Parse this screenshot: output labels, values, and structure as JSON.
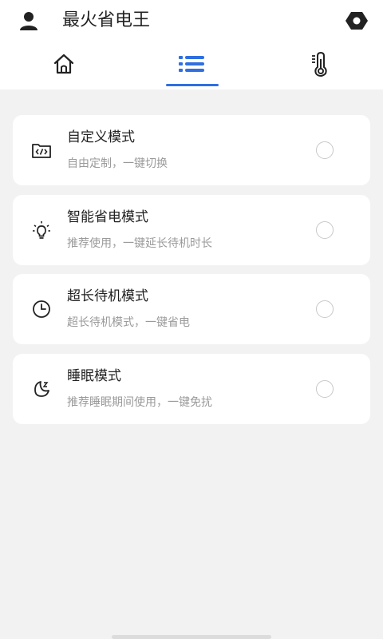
{
  "header": {
    "title": "最火省电王",
    "user_icon": "user-icon",
    "settings_icon": "gear-icon"
  },
  "tabs": [
    {
      "icon": "home-icon",
      "active": false
    },
    {
      "icon": "list-icon",
      "active": true
    },
    {
      "icon": "thermometer-icon",
      "active": false
    }
  ],
  "colors": {
    "accent": "#2f6fe0",
    "background": "#f2f2f2",
    "card": "#ffffff",
    "secondary_text": "#9a9a9a"
  },
  "modes": [
    {
      "title": "自定义模式",
      "desc": "自由定制，一键切换",
      "icon": "custom-code-icon",
      "selected": false
    },
    {
      "title": "智能省电模式",
      "desc": "推荐使用，一键延长待机时长",
      "icon": "lightbulb-icon",
      "selected": false
    },
    {
      "title": "超长待机模式",
      "desc": "超长待机模式，一键省电",
      "icon": "clock-icon",
      "selected": false
    },
    {
      "title": "睡眠模式",
      "desc": "推荐睡眠期间使用，一键免扰",
      "icon": "moon-icon",
      "selected": false
    }
  ]
}
